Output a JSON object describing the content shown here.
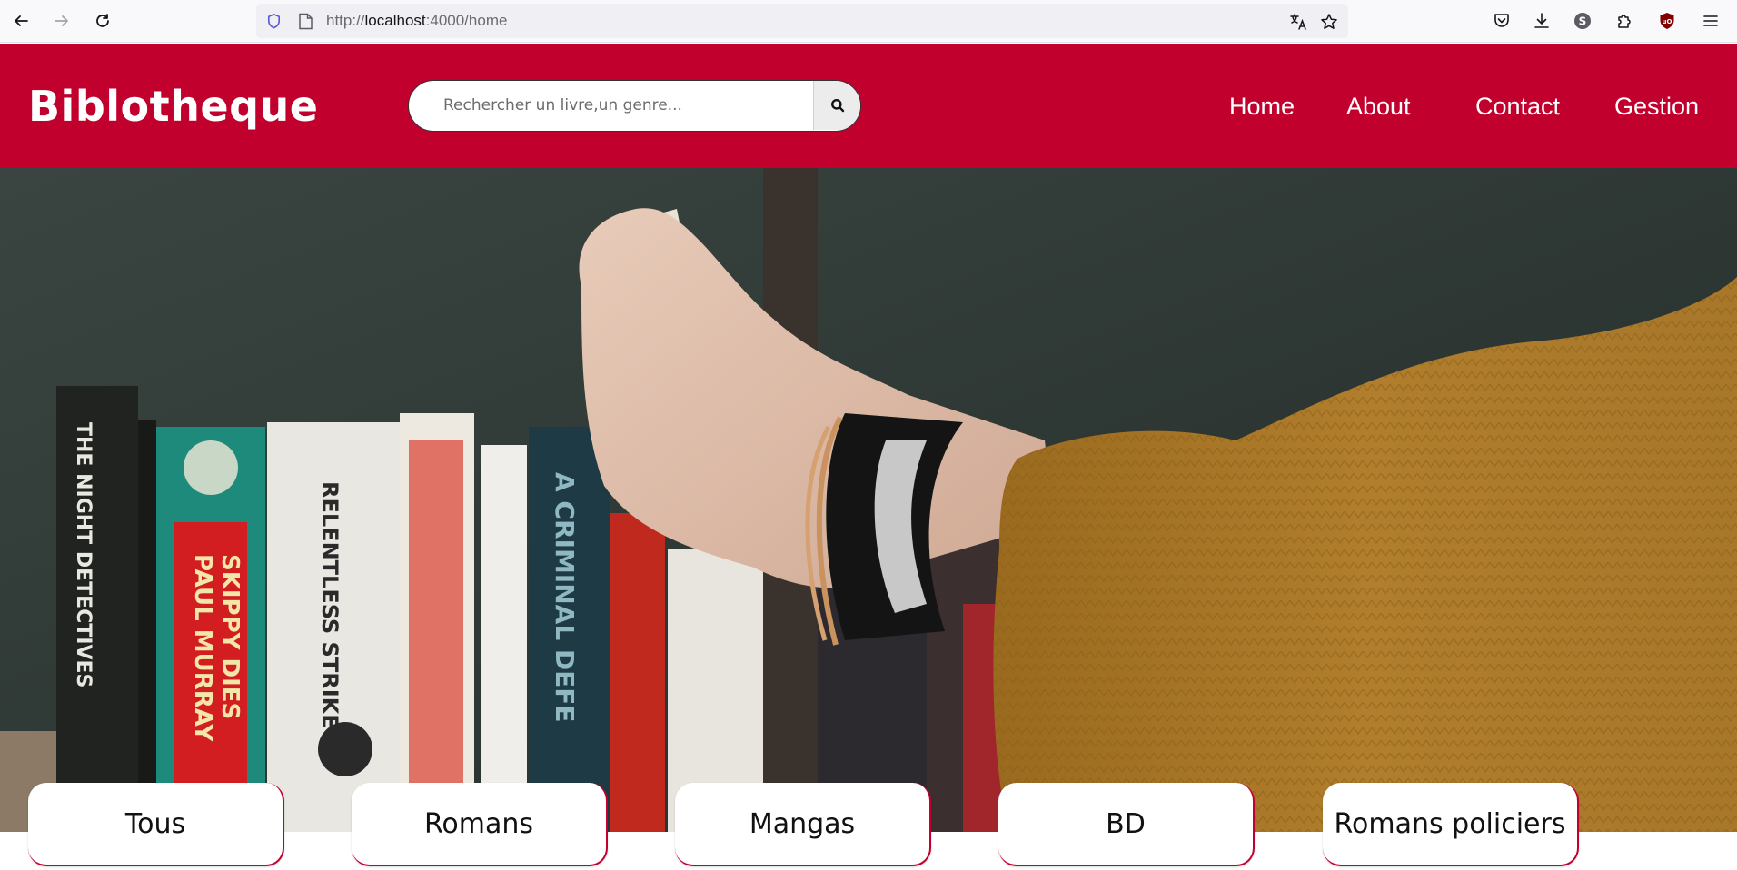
{
  "browser": {
    "url_prefix": "http://",
    "url_host": "localhost",
    "url_rest": ":4000/home"
  },
  "site": {
    "logo": "Biblotheque",
    "search": {
      "placeholder": "Rechercher un livre,un genre..."
    },
    "nav": [
      {
        "label": "Home"
      },
      {
        "label": "About"
      },
      {
        "label": "Contact"
      },
      {
        "label": "Gestion"
      }
    ]
  },
  "categories": [
    {
      "label": "Tous"
    },
    {
      "label": "Romans"
    },
    {
      "label": "Mangas"
    },
    {
      "label": "BD"
    },
    {
      "label": "Romans policiers"
    }
  ],
  "hero": {
    "book_spine_texts": [
      "THE NIGHT DETECTIVES",
      "PAUL MURRAY",
      "SKIPPY DIES",
      "RELENTLESS STRIKE",
      "A CRIMINAL DEFE"
    ]
  },
  "colors": {
    "brand": "#c2002d",
    "toolbar": "#f9f9fb",
    "url_bar": "#f0f0f4"
  },
  "icons": {
    "back": "arrow-left-icon",
    "forward": "arrow-right-icon",
    "reload": "reload-icon",
    "shield": "shield-icon",
    "page": "page-icon",
    "translate": "translate-icon",
    "bookmark": "star-icon",
    "pocket": "pocket-icon",
    "downloads": "download-icon",
    "account": "account-icon",
    "extensions": "puzzle-icon",
    "ublock": "ublock-icon",
    "menu": "hamburger-menu-icon",
    "search": "search-icon"
  }
}
